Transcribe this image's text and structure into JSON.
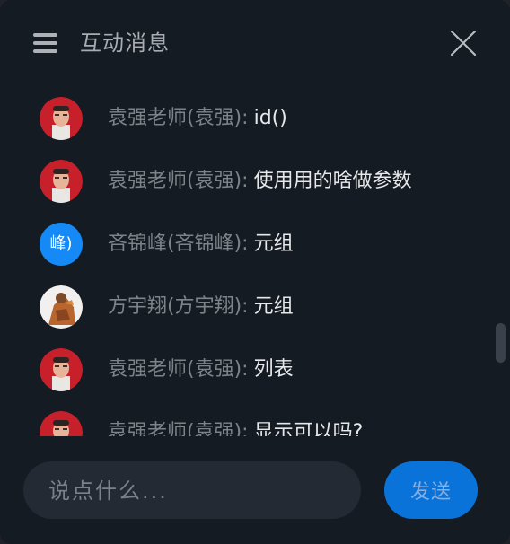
{
  "header": {
    "title": "互动消息",
    "menu_icon": "hamburger-menu-icon",
    "close_icon": "close-icon"
  },
  "messages": [
    {
      "sender": "袁强老师(袁强)",
      "separator": ":",
      "content": "id()",
      "avatar": "photo"
    },
    {
      "sender": "袁强老师(袁强)",
      "separator": ":",
      "content": "使用用的啥做参数",
      "avatar": "photo"
    },
    {
      "sender": "吝锦峰(吝锦峰)",
      "separator": ":",
      "content": "元组",
      "avatar": "text",
      "avatar_text": "峰)"
    },
    {
      "sender": "方宇翔(方宇翔)",
      "separator": ":",
      "content": "元组",
      "avatar": "photo"
    },
    {
      "sender": "袁强老师(袁强)",
      "separator": ":",
      "content": "列表",
      "avatar": "photo"
    },
    {
      "sender": "袁强老师(袁强)",
      "separator": ":",
      "content": "显示可以吗?",
      "avatar": "photo"
    }
  ],
  "composer": {
    "placeholder": "说点什么...",
    "value": "",
    "send_label": "发送"
  },
  "colors": {
    "background": "#151b22",
    "accent": "#0a73d9",
    "sender_text": "#7e838a",
    "content_text": "#e6e8ea"
  }
}
